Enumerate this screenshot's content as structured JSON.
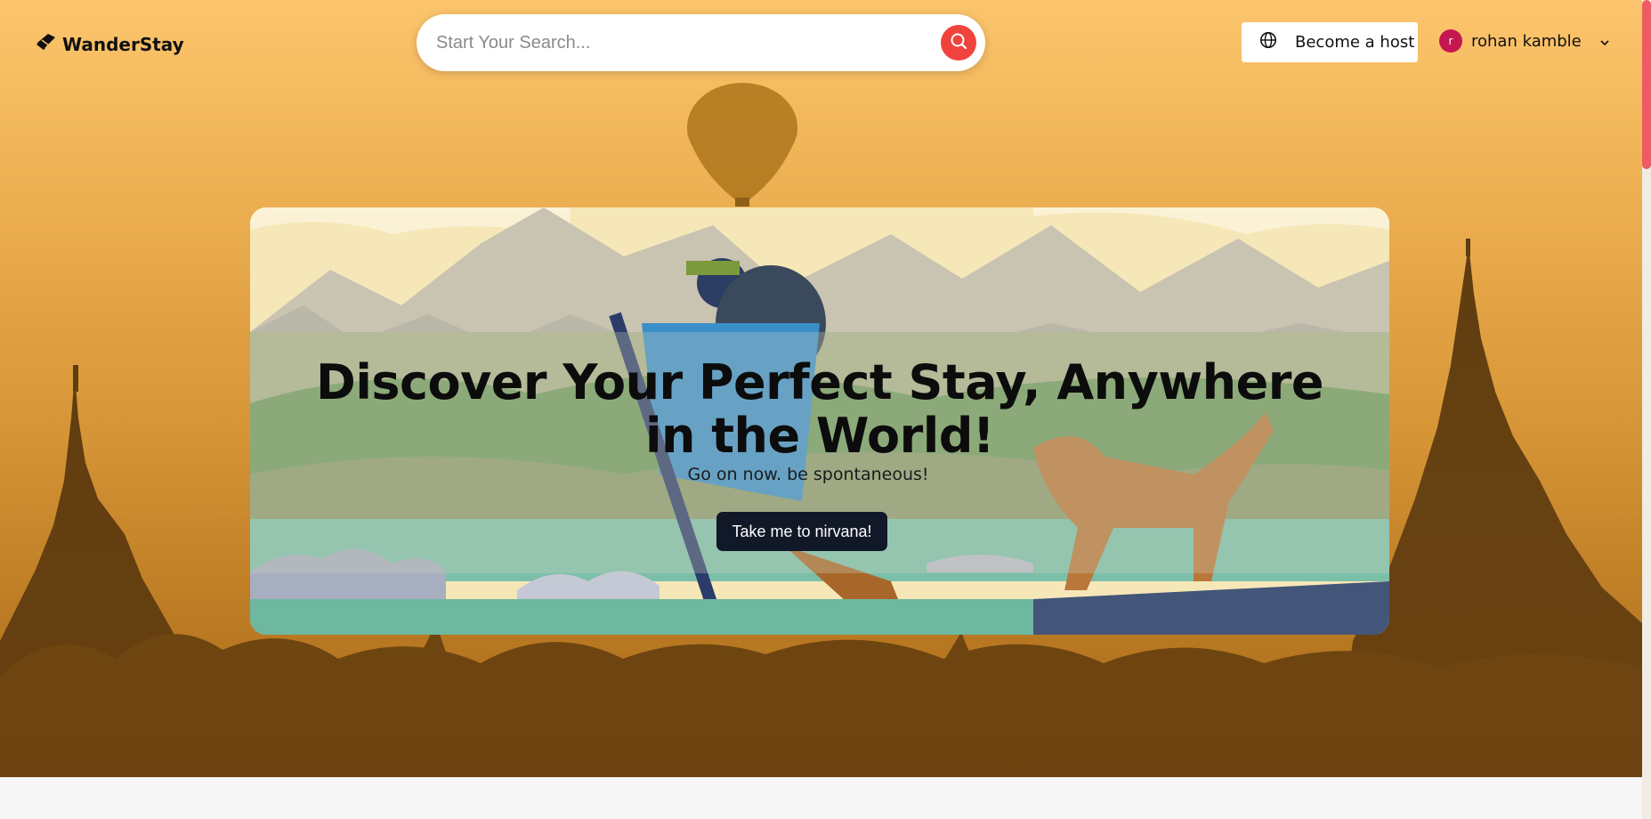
{
  "header": {
    "brand": "WanderStay",
    "search": {
      "placeholder": "Start Your Search..."
    },
    "host_label": "Become a host",
    "user": {
      "initial": "r",
      "name": "rohan kamble"
    }
  },
  "hero": {
    "title": "Discover Your Perfect Stay, Anywhere in the World!",
    "subtitle": "Go on now. be spontaneous!",
    "cta_label": "Take me to nirvana!"
  },
  "colors": {
    "accent": "#f0433d",
    "cta_bg": "#111827",
    "avatar": "#c4174f",
    "sky_top": "#fbbe62",
    "sky_bottom": "#e79b2c"
  },
  "icons": {
    "brand": "ticket-icon",
    "search": "search-icon",
    "host": "globe-icon",
    "user_menu": "chevron-down-icon"
  }
}
